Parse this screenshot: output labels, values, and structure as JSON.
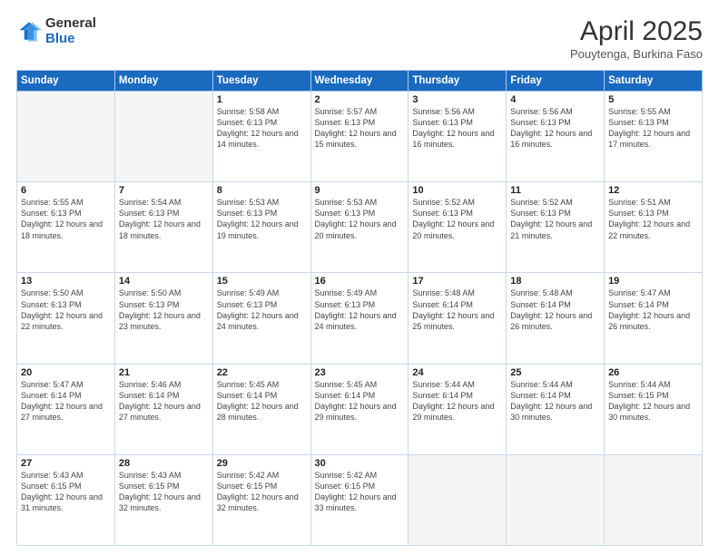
{
  "header": {
    "logo_general": "General",
    "logo_blue": "Blue",
    "title": "April 2025",
    "location": "Pouytenga, Burkina Faso"
  },
  "days_of_week": [
    "Sunday",
    "Monday",
    "Tuesday",
    "Wednesday",
    "Thursday",
    "Friday",
    "Saturday"
  ],
  "weeks": [
    [
      {
        "day": "",
        "info": ""
      },
      {
        "day": "",
        "info": ""
      },
      {
        "day": "1",
        "info": "Sunrise: 5:58 AM\nSunset: 6:13 PM\nDaylight: 12 hours and 14 minutes."
      },
      {
        "day": "2",
        "info": "Sunrise: 5:57 AM\nSunset: 6:13 PM\nDaylight: 12 hours and 15 minutes."
      },
      {
        "day": "3",
        "info": "Sunrise: 5:56 AM\nSunset: 6:13 PM\nDaylight: 12 hours and 16 minutes."
      },
      {
        "day": "4",
        "info": "Sunrise: 5:56 AM\nSunset: 6:13 PM\nDaylight: 12 hours and 16 minutes."
      },
      {
        "day": "5",
        "info": "Sunrise: 5:55 AM\nSunset: 6:13 PM\nDaylight: 12 hours and 17 minutes."
      }
    ],
    [
      {
        "day": "6",
        "info": "Sunrise: 5:55 AM\nSunset: 6:13 PM\nDaylight: 12 hours and 18 minutes."
      },
      {
        "day": "7",
        "info": "Sunrise: 5:54 AM\nSunset: 6:13 PM\nDaylight: 12 hours and 18 minutes."
      },
      {
        "day": "8",
        "info": "Sunrise: 5:53 AM\nSunset: 6:13 PM\nDaylight: 12 hours and 19 minutes."
      },
      {
        "day": "9",
        "info": "Sunrise: 5:53 AM\nSunset: 6:13 PM\nDaylight: 12 hours and 20 minutes."
      },
      {
        "day": "10",
        "info": "Sunrise: 5:52 AM\nSunset: 6:13 PM\nDaylight: 12 hours and 20 minutes."
      },
      {
        "day": "11",
        "info": "Sunrise: 5:52 AM\nSunset: 6:13 PM\nDaylight: 12 hours and 21 minutes."
      },
      {
        "day": "12",
        "info": "Sunrise: 5:51 AM\nSunset: 6:13 PM\nDaylight: 12 hours and 22 minutes."
      }
    ],
    [
      {
        "day": "13",
        "info": "Sunrise: 5:50 AM\nSunset: 6:13 PM\nDaylight: 12 hours and 22 minutes."
      },
      {
        "day": "14",
        "info": "Sunrise: 5:50 AM\nSunset: 6:13 PM\nDaylight: 12 hours and 23 minutes."
      },
      {
        "day": "15",
        "info": "Sunrise: 5:49 AM\nSunset: 6:13 PM\nDaylight: 12 hours and 24 minutes."
      },
      {
        "day": "16",
        "info": "Sunrise: 5:49 AM\nSunset: 6:13 PM\nDaylight: 12 hours and 24 minutes."
      },
      {
        "day": "17",
        "info": "Sunrise: 5:48 AM\nSunset: 6:14 PM\nDaylight: 12 hours and 25 minutes."
      },
      {
        "day": "18",
        "info": "Sunrise: 5:48 AM\nSunset: 6:14 PM\nDaylight: 12 hours and 26 minutes."
      },
      {
        "day": "19",
        "info": "Sunrise: 5:47 AM\nSunset: 6:14 PM\nDaylight: 12 hours and 26 minutes."
      }
    ],
    [
      {
        "day": "20",
        "info": "Sunrise: 5:47 AM\nSunset: 6:14 PM\nDaylight: 12 hours and 27 minutes."
      },
      {
        "day": "21",
        "info": "Sunrise: 5:46 AM\nSunset: 6:14 PM\nDaylight: 12 hours and 27 minutes."
      },
      {
        "day": "22",
        "info": "Sunrise: 5:45 AM\nSunset: 6:14 PM\nDaylight: 12 hours and 28 minutes."
      },
      {
        "day": "23",
        "info": "Sunrise: 5:45 AM\nSunset: 6:14 PM\nDaylight: 12 hours and 29 minutes."
      },
      {
        "day": "24",
        "info": "Sunrise: 5:44 AM\nSunset: 6:14 PM\nDaylight: 12 hours and 29 minutes."
      },
      {
        "day": "25",
        "info": "Sunrise: 5:44 AM\nSunset: 6:14 PM\nDaylight: 12 hours and 30 minutes."
      },
      {
        "day": "26",
        "info": "Sunrise: 5:44 AM\nSunset: 6:15 PM\nDaylight: 12 hours and 30 minutes."
      }
    ],
    [
      {
        "day": "27",
        "info": "Sunrise: 5:43 AM\nSunset: 6:15 PM\nDaylight: 12 hours and 31 minutes."
      },
      {
        "day": "28",
        "info": "Sunrise: 5:43 AM\nSunset: 6:15 PM\nDaylight: 12 hours and 32 minutes."
      },
      {
        "day": "29",
        "info": "Sunrise: 5:42 AM\nSunset: 6:15 PM\nDaylight: 12 hours and 32 minutes."
      },
      {
        "day": "30",
        "info": "Sunrise: 5:42 AM\nSunset: 6:15 PM\nDaylight: 12 hours and 33 minutes."
      },
      {
        "day": "",
        "info": ""
      },
      {
        "day": "",
        "info": ""
      },
      {
        "day": "",
        "info": ""
      }
    ]
  ]
}
